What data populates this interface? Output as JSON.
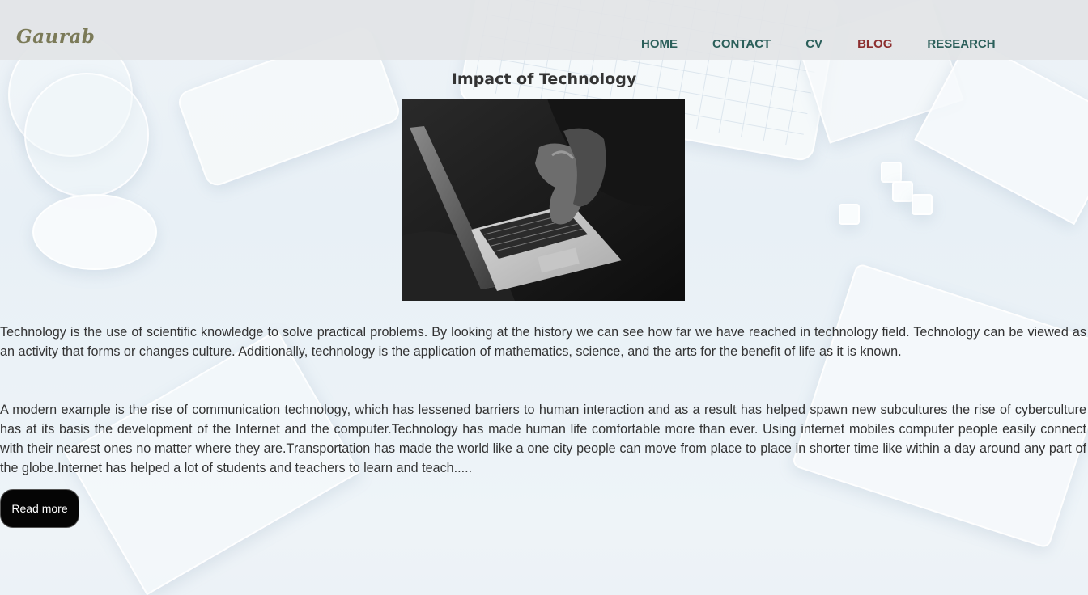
{
  "site": {
    "logo": "Gaurab"
  },
  "nav": {
    "items": [
      {
        "label": "HOME"
      },
      {
        "label": "CONTACT"
      },
      {
        "label": "CV"
      },
      {
        "label": "BLOG"
      },
      {
        "label": "RESEARCH"
      }
    ],
    "active": "BLOG",
    "colors": {
      "link": "#2b5f5a",
      "active": "#8d2f2f"
    }
  },
  "post": {
    "title": "Impact of Technology",
    "image_icon": "laptop-photo",
    "paragraphs": [
      "Technology is the use of scientific knowledge to solve practical problems. By looking at the history we can see how far we have reached in technology field. Technology can be viewed as an activity that forms or changes culture. Additionally, technology is the application of mathematics, science, and the arts for the benefit of life as it is known.",
      "A modern example is the rise of communication technology, which has lessened barriers to human interaction and as a result has helped spawn new subcultures the rise of cyberculture has at its basis the development of the Internet and the computer.Technology has made human life comfortable more than ever. Using internet mobiles computer people easily connect with their nearest ones no matter where they are.Transportation has made the world like a one city people can move from place to place in shorter time like within a day around any part of the globe.Internet has helped a lot of students and teachers to learn and teach....."
    ],
    "read_more_label": "Read more"
  }
}
